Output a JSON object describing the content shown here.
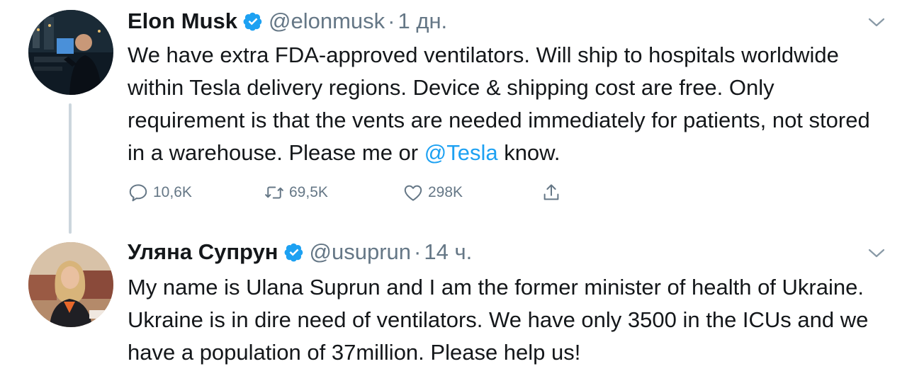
{
  "tweets": [
    {
      "name": "Elon Musk",
      "handle": "@elonmusk",
      "separator": "·",
      "time": "1 дн.",
      "text_before_mention": "We have extra FDA-approved ventilators. Will ship to hospitals worldwide within Tesla delivery regions. Device & shipping cost are free. Only requirement is that the vents are needed immediately for patients, not stored in a warehouse. Please me or ",
      "mention": "@Tesla",
      "text_after_mention": " know.",
      "replies": "10,6K",
      "retweets": "69,5K",
      "likes": "298K",
      "verified": true
    },
    {
      "name": "Уляна Супрун",
      "handle": "@usuprun",
      "separator": "·",
      "time": "14 ч.",
      "text": "My name is Ulana Suprun and I am the former minister of health of Ukraine. Ukraine is in dire need of ventilators. We have only 3500 in the ICUs and we have a population of  37million. Please help us!",
      "verified": true
    }
  ],
  "icons": {
    "verified": "verified-badge-icon",
    "caret": "chevron-down-icon",
    "reply": "reply-icon",
    "retweet": "retweet-icon",
    "like": "heart-icon",
    "share": "share-icon"
  },
  "colors": {
    "text": "#14171a",
    "secondary": "#657786",
    "accent": "#1da1f2",
    "thread_line": "#ccd6dd"
  }
}
